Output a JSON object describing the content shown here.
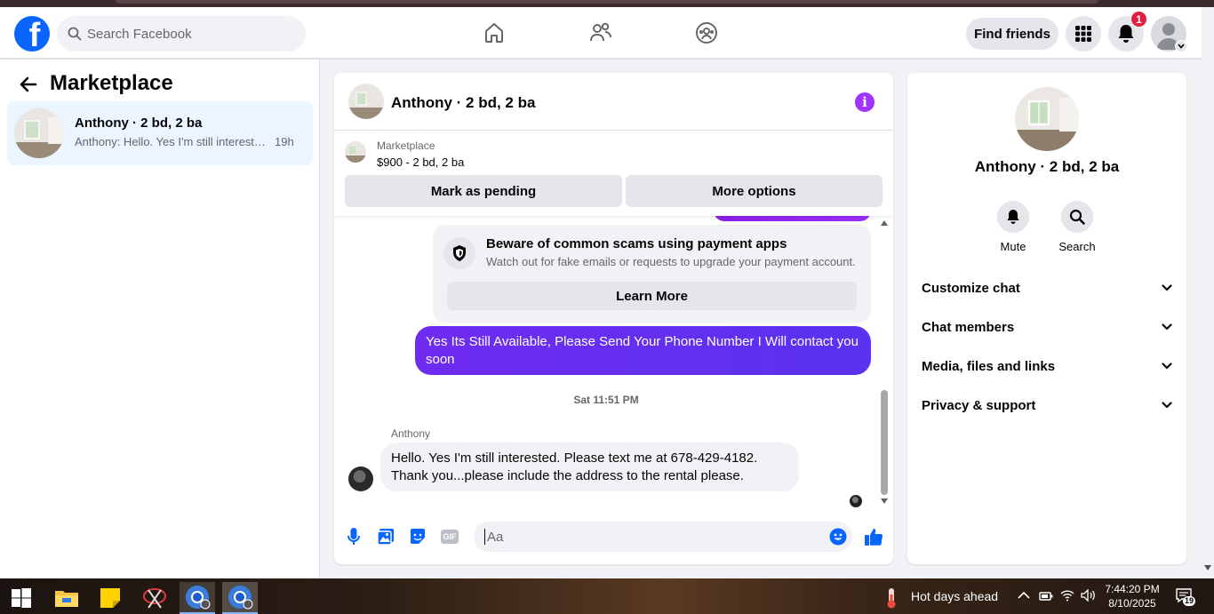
{
  "topbar": {
    "logo_letter": "f",
    "search_placeholder": "Search Facebook",
    "find_friends_label": "Find friends",
    "notification_count": "1"
  },
  "sidebar": {
    "title": "Marketplace",
    "conversation": {
      "name": "Anthony · 2 bd, 2 ba",
      "preview": "Anthony: Hello. Yes I'm still interested. Please text me at 678-429-4182.",
      "time": "19h"
    }
  },
  "chat": {
    "title": "Anthony · 2 bd, 2 ba",
    "marketplace_label": "Marketplace",
    "listing_price": "$900 - 2 bd, 2 ba",
    "mark_pending_label": "Mark as pending",
    "more_options_label": "More options",
    "scam_notice": {
      "heading": "Beware of common scams using payment apps",
      "subtext": "Watch out for fake emails or requests to upgrade your payment account.",
      "button_label": "Learn More"
    },
    "outgoing_message": "Yes Its Still Available, Please Send Your Phone Number I Will contact you soon",
    "timestamp": "Sat 11:51 PM",
    "incoming_sender": "Anthony",
    "incoming_message_line1": "Hello. Yes I'm still interested. Please text me at 678-429-4182.",
    "incoming_message_line2": "Thank you...please include the address to the rental please.",
    "composer_placeholder": "Aa",
    "gif_label": "GIF"
  },
  "details": {
    "title": "Anthony · 2 bd, 2 ba",
    "mute_label": "Mute",
    "search_label": "Search",
    "sections": [
      "Customize chat",
      "Chat members",
      "Media, files and links",
      "Privacy & support"
    ]
  },
  "taskbar": {
    "weather": "Hot days ahead",
    "time": "7:44:20 PM",
    "date": "8/10/2025",
    "notification_count": "19"
  },
  "colors": {
    "facebook_blue": "#0866ff",
    "messenger_purple": "#6f2cf0",
    "info_purple": "#a033ff",
    "badge_red": "#e41e3f"
  }
}
